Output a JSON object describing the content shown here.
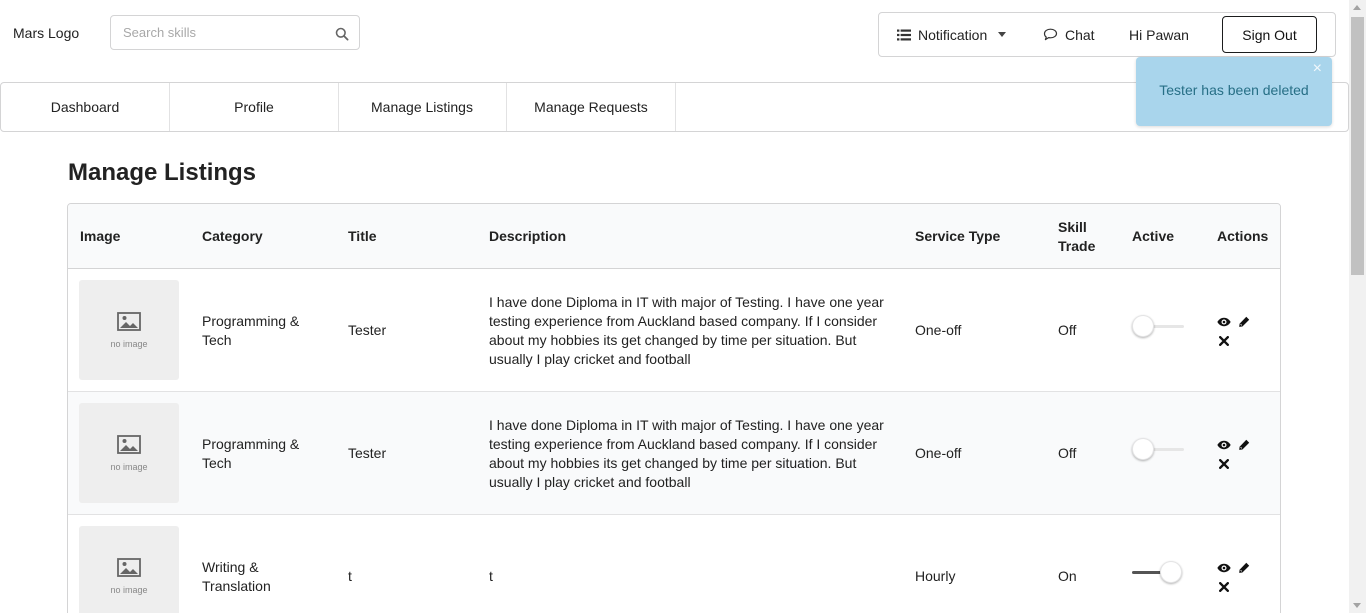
{
  "header": {
    "logo_text": "Mars Logo",
    "search": {
      "placeholder": "Search skills",
      "value": "",
      "icon": "search-icon"
    },
    "menu": {
      "notification_label": "Notification",
      "chat_label": "Chat",
      "greeting": "Hi Pawan",
      "signout_label": "Sign Out"
    }
  },
  "nav": {
    "tabs": [
      {
        "label": "Dashboard"
      },
      {
        "label": "Profile"
      },
      {
        "label": "Manage Listings"
      },
      {
        "label": "Manage Requests"
      }
    ]
  },
  "toast": {
    "message": "Tester has been deleted",
    "close_glyph": "×",
    "color": "#a9d5ec"
  },
  "page": {
    "title": "Manage Listings"
  },
  "table": {
    "columns": [
      "Image",
      "Category",
      "Title",
      "Description",
      "Service Type",
      "Skill Trade",
      "Active",
      "Actions"
    ],
    "rows": [
      {
        "image": "no image",
        "category": "Programming & Tech",
        "title": "Tester",
        "description": "I have done Diploma in IT with major of Testing. I have one year testing experience from Auckland based company. If I consider about my hobbies its get changed by time per situation. But usually I play cricket and football",
        "service_type": "One-off",
        "skill_trade": "Off",
        "active": false
      },
      {
        "image": "no image",
        "category": "Programming & Tech",
        "title": "Tester",
        "description": "I have done Diploma in IT with major of Testing. I have one year testing experience from Auckland based company. If I consider about my hobbies its get changed by time per situation. But usually I play cricket and football",
        "service_type": "One-off",
        "skill_trade": "Off",
        "active": false
      },
      {
        "image": "no image",
        "category": "Writing & Translation",
        "title": "t",
        "description": "t",
        "service_type": "Hourly",
        "skill_trade": "On",
        "active": true
      }
    ],
    "action_icons": [
      "eye-icon",
      "pencil-icon",
      "close-icon"
    ]
  }
}
